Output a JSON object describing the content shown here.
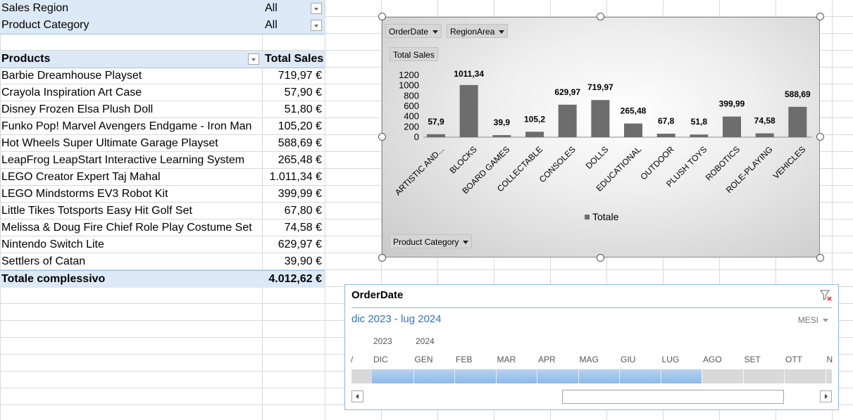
{
  "filters": [
    {
      "label": "Sales Region",
      "value": "All"
    },
    {
      "label": "Product Category",
      "value": "All"
    }
  ],
  "pivot": {
    "header_products": "Products",
    "header_total": "Total Sales",
    "rows": [
      {
        "product": "Barbie Dreamhouse Playset",
        "total": "719,97 €"
      },
      {
        "product": "Crayola Inspiration Art Case",
        "total": "57,90 €"
      },
      {
        "product": "Disney Frozen Elsa Plush Doll",
        "total": "51,80 €"
      },
      {
        "product": "Funko Pop! Marvel Avengers Endgame - Iron Man",
        "total": "105,20 €"
      },
      {
        "product": "Hot Wheels Super Ultimate Garage Playset",
        "total": "588,69 €"
      },
      {
        "product": "LeapFrog LeapStart Interactive Learning System",
        "total": "265,48 €"
      },
      {
        "product": "LEGO Creator Expert Taj Mahal",
        "total": "1.011,34 €"
      },
      {
        "product": "LEGO Mindstorms EV3 Robot Kit",
        "total": "399,99 €"
      },
      {
        "product": "Little Tikes Totsports Easy Hit Golf Set",
        "total": "67,80 €"
      },
      {
        "product": "Melissa & Doug Fire Chief Role Play Costume Set",
        "total": "74,58 €"
      },
      {
        "product": "Nintendo Switch Lite",
        "total": "629,97 €"
      },
      {
        "product": "Settlers of Catan",
        "total": "39,90 €"
      }
    ],
    "grand_total_label": "Totale complessivo",
    "grand_total_value": "4.012,62 €"
  },
  "chart_buttons": {
    "order_date": "OrderDate",
    "region_area": "RegionArea",
    "total_sales": "Total Sales",
    "product_category": "Product  Category"
  },
  "chart_data": {
    "type": "bar",
    "categories": [
      "ARTISTIC AND...",
      "BLOCKS",
      "BOARD GAMES",
      "COLLECTABLE",
      "CONSOLES",
      "DOLLS",
      "EDUCATIONAL",
      "OUTDOOR",
      "PLUSH TOYS",
      "ROBOTICS",
      "ROLE-PLAYING",
      "VEHICLES"
    ],
    "series": [
      {
        "name": "Totale",
        "values": [
          57.9,
          1011.34,
          39.9,
          105.2,
          629.97,
          719.97,
          265.48,
          67.8,
          51.8,
          399.99,
          74.58,
          588.69
        ]
      }
    ],
    "data_labels": [
      "57,9",
      "1011,34",
      "39,9",
      "105,2",
      "629,97",
      "719,97",
      "265,48",
      "67,8",
      "51,8",
      "399,99",
      "74,58",
      "588,69"
    ],
    "yticks": [
      "0",
      "200",
      "400",
      "600",
      "800",
      "1000",
      "1200"
    ],
    "ylim": [
      0,
      1200
    ],
    "legend_position": "bottom",
    "bar_color": "#6d6d6d"
  },
  "slicer": {
    "title": "OrderDate",
    "range": "dic 2023 - lug 2024",
    "level": "MESI",
    "years": [
      "2023",
      "2024"
    ],
    "months": [
      "DIC",
      "GEN",
      "FEB",
      "MAR",
      "APR",
      "MAG",
      "GIU",
      "LUG",
      "AGO",
      "SET",
      "OTT",
      "N"
    ],
    "selected_months": 8,
    "accent": "#2e75b6"
  }
}
